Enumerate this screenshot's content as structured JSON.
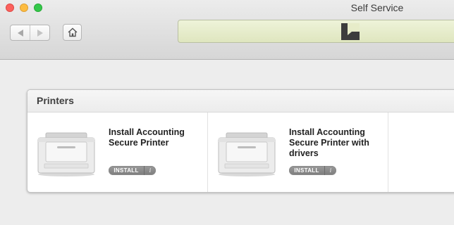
{
  "window": {
    "title": "Self Service"
  },
  "toolbar": {
    "back_icon": "chevron-left-icon",
    "forward_icon": "chevron-right-icon",
    "home_icon": "house-icon"
  },
  "section": {
    "title": "Printers",
    "items": [
      {
        "title": "Install Accounting Secure Printer",
        "action_label": "INSTALL",
        "info_label": "i",
        "icon": "printer-icon"
      },
      {
        "title": "Install Accounting Secure Printer with drivers",
        "action_label": "INSTALL",
        "info_label": "i",
        "icon": "printer-icon"
      }
    ]
  },
  "colors": {
    "status_bar": "#e7ecc9",
    "install_button": "#8c8c8c",
    "close": "#fc615d",
    "minimize": "#fdbc40",
    "maximize": "#34c84a"
  }
}
